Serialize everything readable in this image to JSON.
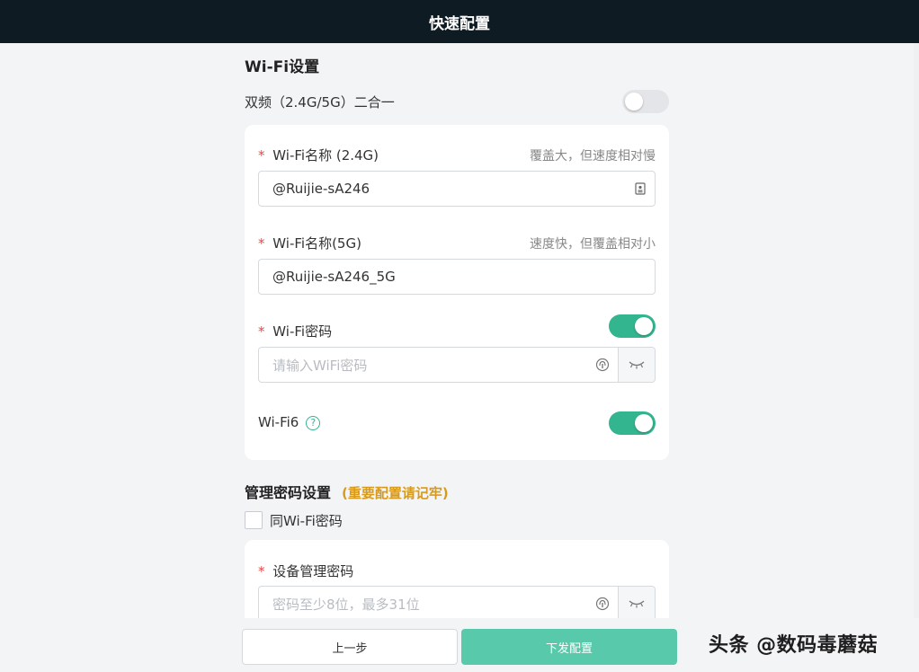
{
  "header": {
    "title": "快速配置"
  },
  "wifi_section": {
    "title": "Wi-Fi设置",
    "dual_band_label": "双频（2.4G/5G）二合一",
    "dual_band_enabled": false,
    "ssid_24": {
      "required_mark": "*",
      "label": "Wi-Fi名称 (2.4G)",
      "hint": "覆盖大，但速度相对慢",
      "value": "@Ruijie-sA246"
    },
    "ssid_5": {
      "required_mark": "*",
      "label": "Wi-Fi名称(5G)",
      "hint": "速度快，但覆盖相对小",
      "value": "@Ruijie-sA246_5G"
    },
    "password": {
      "required_mark": "*",
      "label": "Wi-Fi密码",
      "enabled": true,
      "placeholder": "请输入WiFi密码"
    },
    "wifi6": {
      "label": "Wi-Fi6",
      "help_glyph": "?",
      "enabled": true
    }
  },
  "admin_section": {
    "title": "管理密码设置",
    "note": "(重要配置请记牢)",
    "same_as_wifi_label": "同Wi-Fi密码",
    "same_as_wifi_checked": false,
    "admin_password": {
      "required_mark": "*",
      "label": "设备管理密码",
      "placeholder": "密码至少8位，最多31位"
    }
  },
  "footer": {
    "prev_label": "上一步",
    "submit_label": "下发配置"
  },
  "watermark": "头条 @数码毒蘑菇",
  "colors": {
    "accent": "#33b58f",
    "header_bg": "#0f1b22",
    "note": "#d89a1c",
    "required": "#e24a4a",
    "submit_bg": "#58c9aa"
  },
  "icons": {
    "ssid_input": "id-card-icon",
    "password_input": "fingerprint-icon",
    "visibility": "eye-closed-icon",
    "help": "question-circle-icon"
  }
}
